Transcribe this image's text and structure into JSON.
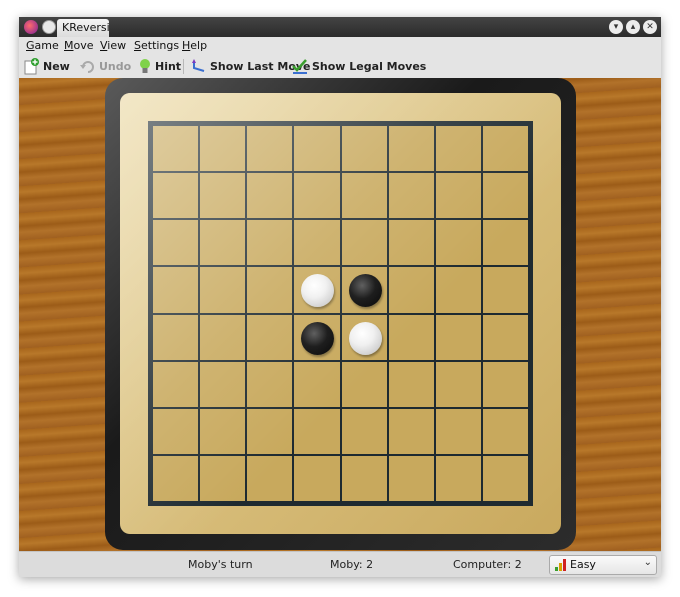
{
  "window": {
    "title": "KReversi"
  },
  "menu": [
    "Game",
    "Move",
    "View",
    "Settings",
    "Help"
  ],
  "toolbar": {
    "new_label": "New",
    "undo_label": "Undo",
    "hint_label": "Hint",
    "show_last_move_label": "Show Last Move",
    "show_legal_moves_label": "Show Legal Moves"
  },
  "board": {
    "size": 8,
    "discs": [
      {
        "row": 3,
        "col": 3,
        "color": "white"
      },
      {
        "row": 3,
        "col": 4,
        "color": "black"
      },
      {
        "row": 4,
        "col": 3,
        "color": "black"
      },
      {
        "row": 4,
        "col": 4,
        "color": "white"
      }
    ]
  },
  "status": {
    "turn": "Moby's turn",
    "player_score": "Moby: 2",
    "computer_score": "Computer: 2",
    "difficulty": "Easy"
  },
  "colors": {
    "board": "#c8a95d",
    "grid_lines": "#1e2a30",
    "table_wood": "#a8661c"
  }
}
